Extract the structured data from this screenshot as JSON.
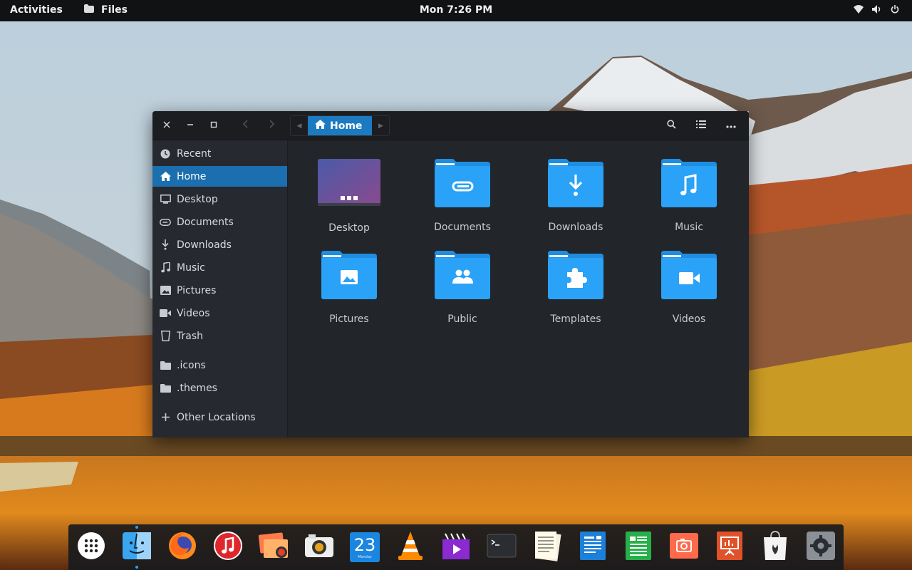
{
  "topbar": {
    "activities": "Activities",
    "app_name": "Files",
    "clock": "Mon  7:26 PM",
    "tray_icons": [
      "wifi-icon",
      "volume-icon",
      "power-icon"
    ]
  },
  "window": {
    "path": {
      "current": "Home"
    },
    "sidebar": {
      "items": [
        {
          "label": "Recent",
          "icon": "clock-icon"
        },
        {
          "label": "Home",
          "icon": "home-icon",
          "active": true
        },
        {
          "label": "Desktop",
          "icon": "monitor-icon"
        },
        {
          "label": "Documents",
          "icon": "documents-icon"
        },
        {
          "label": "Downloads",
          "icon": "download-icon"
        },
        {
          "label": "Music",
          "icon": "music-icon"
        },
        {
          "label": "Pictures",
          "icon": "picture-icon"
        },
        {
          "label": "Videos",
          "icon": "video-icon"
        },
        {
          "label": "Trash",
          "icon": "trash-icon"
        }
      ],
      "bookmarks": [
        {
          "label": ".icons",
          "icon": "folder-icon"
        },
        {
          "label": ".themes",
          "icon": "folder-icon"
        }
      ],
      "other_locations": "Other Locations"
    },
    "folders": [
      {
        "label": "Desktop",
        "icon": "desktop-folder-icon"
      },
      {
        "label": "Documents",
        "icon": "documents-folder-icon"
      },
      {
        "label": "Downloads",
        "icon": "downloads-folder-icon"
      },
      {
        "label": "Music",
        "icon": "music-folder-icon"
      },
      {
        "label": "Pictures",
        "icon": "pictures-folder-icon"
      },
      {
        "label": "Public",
        "icon": "public-folder-icon"
      },
      {
        "label": "Templates",
        "icon": "templates-folder-icon"
      },
      {
        "label": "Videos",
        "icon": "videos-folder-icon"
      }
    ]
  },
  "dock": {
    "calendar_day": "23",
    "calendar_month": "Monday",
    "apps": [
      "show-apps",
      "finder",
      "firefox",
      "music",
      "image-viewer",
      "camera",
      "calendar",
      "vlc",
      "video-editor",
      "terminal",
      "text-editor",
      "writer",
      "calc",
      "screenshot",
      "impress",
      "software-store",
      "settings"
    ]
  },
  "colors": {
    "accent": "#1c7bc0",
    "folder": "#2a9df4",
    "window_bg": "#22252a",
    "sidebar_bg": "#262a30"
  }
}
